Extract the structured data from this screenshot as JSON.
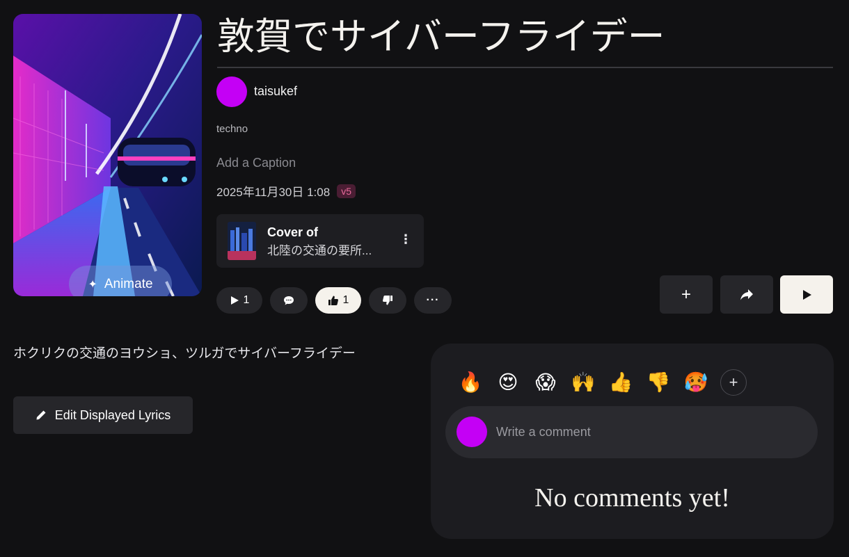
{
  "song": {
    "title": "敦賀でサイバーフライデー",
    "artist": "taisukef",
    "genre": "techno",
    "caption_placeholder": "Add a Caption",
    "date": "2025年11月30日 1:08",
    "version_badge": "v5"
  },
  "cover": {
    "animate_label": "Animate"
  },
  "cover_of": {
    "label": "Cover of",
    "source_title": "北陸の交通の要所...",
    "more_icon": "⋮"
  },
  "actions": {
    "play_count": "1",
    "like_count": "1",
    "more_icon": "···"
  },
  "buttons": {
    "add_icon": "+",
    "share_icon": "share-icon",
    "play_icon": "play-icon"
  },
  "lyrics": {
    "text": "ホクリクの交通のヨウショ、ツルガでサイバーフライデー",
    "edit_label": "Edit Displayed Lyrics"
  },
  "comments": {
    "reactions": [
      "🔥",
      "😍",
      "😱",
      "🙌",
      "👍",
      "👎",
      "🥵"
    ],
    "add_reaction_icon": "+",
    "input_placeholder": "Write a comment",
    "empty_text": "No comments yet!"
  },
  "colors": {
    "background": "#111113",
    "avatar": "#c400f5",
    "badge": "#e86a9a",
    "panel": "#1c1c20"
  }
}
